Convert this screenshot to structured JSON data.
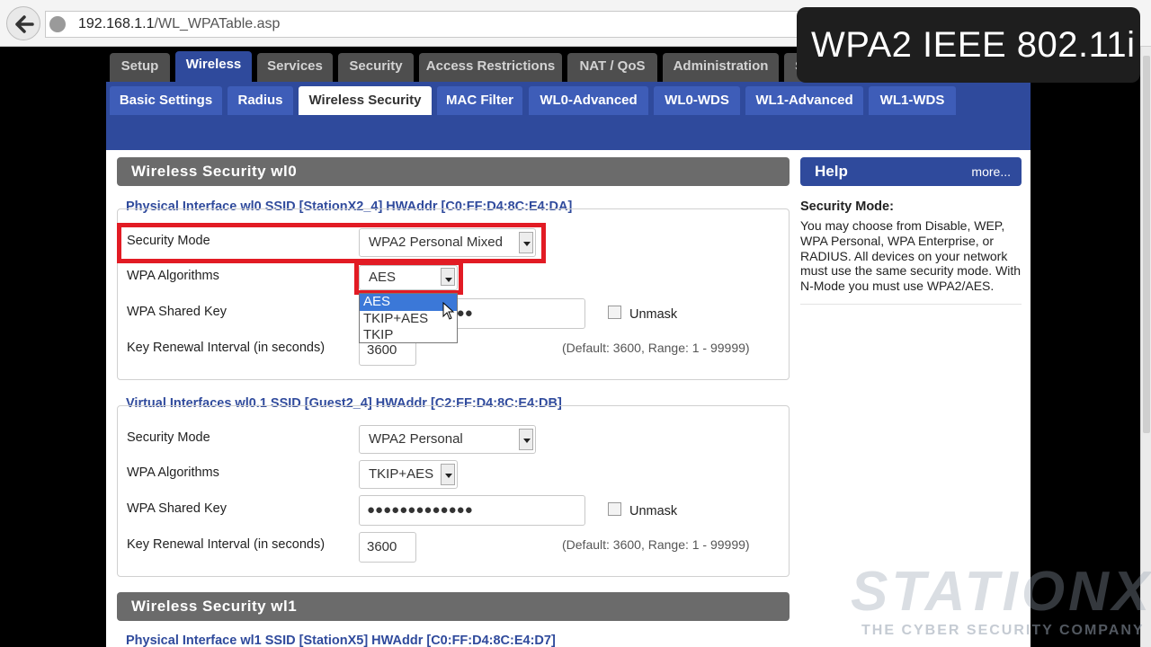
{
  "browser": {
    "url_host": "192.168.1.1",
    "url_path": "/WL_WPATable.asp"
  },
  "caption": "WPA2 IEEE 802.11i",
  "main_tabs": [
    "Setup",
    "Wireless",
    "Services",
    "Security",
    "Access Restrictions",
    "NAT / QoS",
    "Administration",
    "Status"
  ],
  "sub_tabs": [
    "Basic Settings",
    "Radius",
    "Wireless Security",
    "MAC Filter",
    "WL0-Advanced",
    "WL0-WDS",
    "WL1-Advanced",
    "WL1-WDS"
  ],
  "section_wl0": {
    "title": "Wireless Security wl0",
    "physical": {
      "title": "Physical Interface wl0 SSID [StationX2_4] HWAddr [C0:FF:D4:8C:E4:DA]",
      "security_mode_label": "Security Mode",
      "security_mode_value": "WPA2 Personal Mixed",
      "wpa_algorithms_label": "WPA Algorithms",
      "wpa_algorithms_value": "AES",
      "algorithm_options": [
        "AES",
        "TKIP+AES",
        "TKIP"
      ],
      "shared_key_label": "WPA Shared Key",
      "shared_key_value": "●●●●●●●●●●●●●",
      "unmask_label": "Unmask",
      "renewal_label": "Key Renewal Interval (in seconds)",
      "renewal_value": "3600",
      "renewal_hint": "(Default: 3600, Range: 1 - 99999)"
    },
    "virtual": {
      "title": "Virtual Interfaces wl0.1 SSID [Guest2_4] HWAddr [C2:FF:D4:8C:E4:DB]",
      "security_mode_label": "Security Mode",
      "security_mode_value": "WPA2 Personal",
      "wpa_algorithms_label": "WPA Algorithms",
      "wpa_algorithms_value": "TKIP+AES",
      "shared_key_label": "WPA Shared Key",
      "shared_key_value": "●●●●●●●●●●●●●",
      "unmask_label": "Unmask",
      "renewal_label": "Key Renewal Interval (in seconds)",
      "renewal_value": "3600",
      "renewal_hint": "(Default: 3600, Range: 1 - 99999)"
    }
  },
  "section_wl1": {
    "title": "Wireless Security wl1",
    "physical_title": "Physical Interface wl1 SSID [StationX5] HWAddr [C0:FF:D4:8C:E4:D7]"
  },
  "help": {
    "title": "Help",
    "more": "more...",
    "topic": "Security Mode:",
    "text": "You may choose from Disable, WEP, WPA Personal, WPA Enterprise, or RADIUS. All devices on your network must use the same security mode. With N-Mode you must use WPA2/AES."
  },
  "watermark": {
    "brand": "STATIONX",
    "tagline": "THE CYBER SECURITY COMPANY"
  },
  "colors": {
    "accent_blue": "#2f4a9c",
    "highlight_red": "#e21b24"
  }
}
